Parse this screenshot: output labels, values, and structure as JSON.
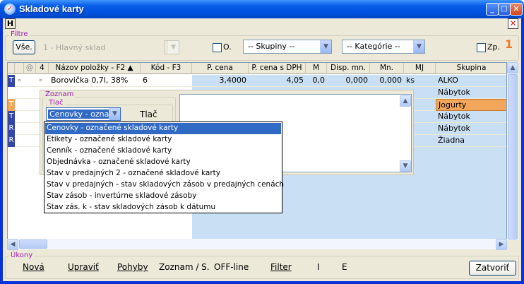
{
  "window": {
    "title": "Skladové karty",
    "icon": "app-icon",
    "minimize": "_",
    "maximize": "□",
    "close": "✕"
  },
  "menu": {
    "h_label": "H",
    "close_label": "✕"
  },
  "filter": {
    "legend": "Filtre",
    "all_button": "Vše.",
    "store": "1 - Hlavný sklad",
    "o_check_label": "O.",
    "groups_combo": "-- Skupiny --",
    "category_combo": "-- Kategórie --",
    "zp_check_label": "Zp.",
    "counter": "1"
  },
  "grid": {
    "columns": [
      "@",
      "4",
      "Názov položky - F2 ▲",
      "Kód - F3",
      "P. cena",
      "P. cena s DPH",
      "M",
      "Disp. mn.",
      "Mn.",
      "MJ",
      "Skupina"
    ],
    "rows": [
      {
        "ind": "T",
        "dot": "∘",
        "name": "Borovička 0,7l, 38%",
        "code": "6",
        "price": "3,4000",
        "price_vat": "4,05",
        "m": "0,0",
        "disp": "0,000",
        "qty": "0,000",
        "mj": "ks",
        "group": "ALKO"
      },
      {
        "ind": "",
        "dot": "",
        "name": "",
        "code": "",
        "price": "",
        "price_vat": "",
        "m": "",
        "disp": "",
        "qty": "",
        "mj": "",
        "group": "Nábytok"
      },
      {
        "ind": "T",
        "dot": "",
        "name": "",
        "code": "",
        "price": "",
        "price_vat": "",
        "m": "",
        "disp": "",
        "qty": "",
        "mj": "",
        "group": "Jogurty"
      },
      {
        "ind": "T",
        "dot": "",
        "name": "",
        "code": "",
        "price": "",
        "price_vat": "",
        "m": "",
        "disp": "",
        "qty": "",
        "mj": "",
        "group": "Nábytok"
      },
      {
        "ind": "R",
        "dot": "",
        "name": "",
        "code": "",
        "price": "",
        "price_vat": "",
        "m": "",
        "disp": "",
        "qty": "",
        "mj": "",
        "group": "Nábytok"
      },
      {
        "ind": "R",
        "dot": "",
        "name": "",
        "code": "",
        "price": "",
        "price_vat": "",
        "m": "",
        "disp": "",
        "qty": "",
        "mj": "",
        "group": "Žiadna"
      }
    ]
  },
  "popup": {
    "legend_zoznam": "Zoznam",
    "legend_tlac": "Tlač",
    "selected": "Cenovky - označe",
    "print_button": "Tlač",
    "options": [
      "Cenovky - označené skladové karty",
      "Etikety - označené skladové karty",
      "Cenník - označené skladové karty",
      "Objednávka - označené skladové karty",
      "Stav v predajných 2 - označené skladové karty",
      "Stav v predajných - stav skladových zásob v predajných cenách",
      "Stav zásob - invertúrne skladové zásoby",
      "Stav zás. k - stav skladových zásob k dátumu"
    ]
  },
  "actions": {
    "legend": "Úkony",
    "new": "Nová",
    "edit": "Upraviť",
    "moves": "Pohyby",
    "list": "Zoznam / S.",
    "offline": "OFF-line",
    "filter": "Filter",
    "i": "I",
    "e": "E",
    "close": "Zatvoriť"
  },
  "colors": {
    "title_blue": "#0054e3",
    "selection": "#316ac5",
    "highlight_row": "#f2a65a",
    "price_cells": "#c9dff3",
    "counter": "#f07828"
  }
}
